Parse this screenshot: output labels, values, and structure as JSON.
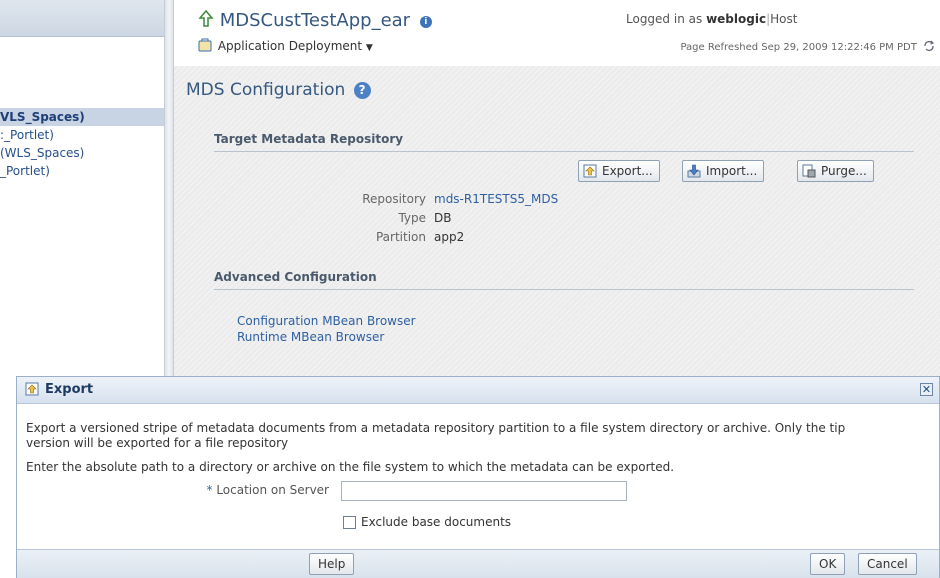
{
  "left_nav": {
    "items": [
      {
        "label": "VLS_Spaces)",
        "selected": true
      },
      {
        "label": ":_Portlet)",
        "selected": false
      },
      {
        "label": "(WLS_Spaces)",
        "selected": false
      },
      {
        "label": "_Portlet)",
        "selected": false
      }
    ]
  },
  "header": {
    "app_title": "MDSCustTestApp_ear",
    "menu_label": "Application Deployment",
    "logged_in_prefix": "Logged in as",
    "user": "weblogic",
    "host_label": "Host",
    "refreshed": "Page Refreshed Sep 29, 2009 12:22:46 PM PDT"
  },
  "main": {
    "title": "MDS Configuration",
    "target_section": "Target Metadata Repository",
    "buttons": {
      "export": "Export...",
      "import": "Import...",
      "purge": "Purge..."
    },
    "fields": [
      {
        "label": "Repository",
        "value": "mds-R1TESTS5_MDS"
      },
      {
        "label": "Type",
        "value": "DB"
      },
      {
        "label": "Partition",
        "value": "app2"
      }
    ],
    "advanced_section": "Advanced Configuration",
    "links": [
      "Configuration MBean Browser",
      "Runtime MBean Browser"
    ]
  },
  "dialog": {
    "title": "Export",
    "desc_line1": "Export a versioned stripe of metadata documents from a metadata repository partition to a file system directory or archive. Only the tip",
    "desc_line2": "version will be exported for a file repository",
    "instruction": "Enter the absolute path to a directory or archive on the file system to which the metadata can be exported.",
    "location_label": "Location on Server",
    "location_value": "",
    "exclude_label": "Exclude base documents",
    "exclude_checked": false,
    "help_button": "Help",
    "ok_button": "OK",
    "cancel_button": "Cancel"
  },
  "colors": {
    "link": "#2e5fa3",
    "title": "#36587f",
    "accent": "#3d73b8"
  }
}
